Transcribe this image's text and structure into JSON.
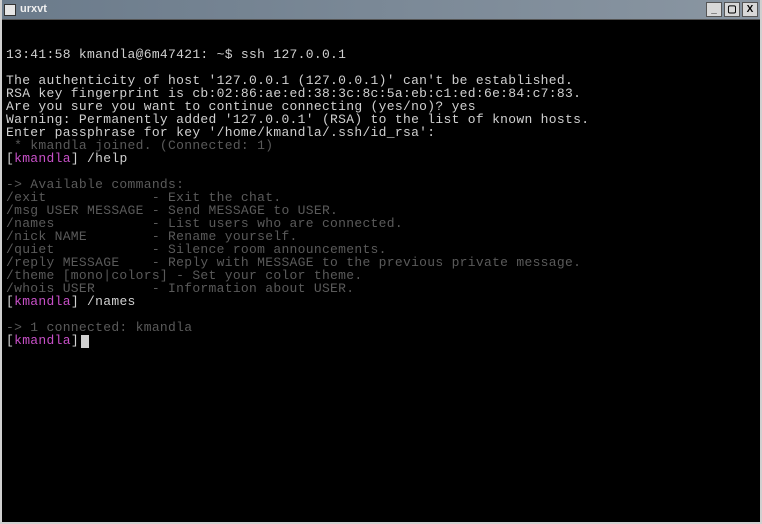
{
  "window": {
    "title": "urxvt",
    "btn_min": "_",
    "btn_max": "▢",
    "btn_close": "X"
  },
  "prompt_line": "13:41:58 kmandla@6m47421: ~$ ssh 127.0.0.1",
  "ssh": {
    "l1": "The authenticity of host '127.0.0.1 (127.0.0.1)' can't be established.",
    "l2": "RSA key fingerprint is cb:02:86:ae:ed:38:3c:8c:5a:eb:c1:ed:6e:84:c7:83.",
    "l3": "Are you sure you want to continue connecting (yes/no)? yes",
    "l4": "Warning: Permanently added '127.0.0.1' (RSA) to the list of known hosts.",
    "l5": "Enter passphrase for key '/home/kmandla/.ssh/id_rsa':"
  },
  "chat": {
    "joined": " * kmandla joined. (Connected: 1)",
    "user": "kmandla",
    "bracket_open": "[",
    "bracket_close": "]",
    "cmd_help": " /help",
    "avail_header": "-> Available commands:",
    "help1": "/exit             - Exit the chat.",
    "help2": "/msg USER MESSAGE - Send MESSAGE to USER.",
    "help3": "/names            - List users who are connected.",
    "help4": "/nick NAME        - Rename yourself.",
    "help5": "/quiet            - Silence room announcements.",
    "help6": "/reply MESSAGE    - Reply with MESSAGE to the previous private message.",
    "help7": "/theme [mono|colors] - Set your color theme.",
    "help8": "/whois USER       - Information about USER.",
    "cmd_names": " /names",
    "names_out": "-> 1 connected: kmandla"
  }
}
